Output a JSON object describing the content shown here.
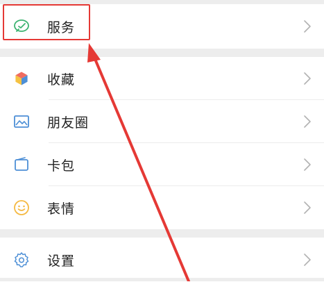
{
  "menu": {
    "service": {
      "label": "服务",
      "icon": "wechat-pay-icon"
    },
    "items": [
      {
        "label": "收藏",
        "icon": "favorites-cube-icon"
      },
      {
        "label": "朋友圈",
        "icon": "moments-photo-icon"
      },
      {
        "label": "卡包",
        "icon": "card-wallet-icon"
      },
      {
        "label": "表情",
        "icon": "emoji-smile-icon"
      }
    ],
    "settings": {
      "label": "设置",
      "icon": "gear-icon"
    }
  },
  "colors": {
    "accent_green": "#3cb371",
    "annotation_red": "#e53935",
    "chevron": "#b2b2b2"
  }
}
